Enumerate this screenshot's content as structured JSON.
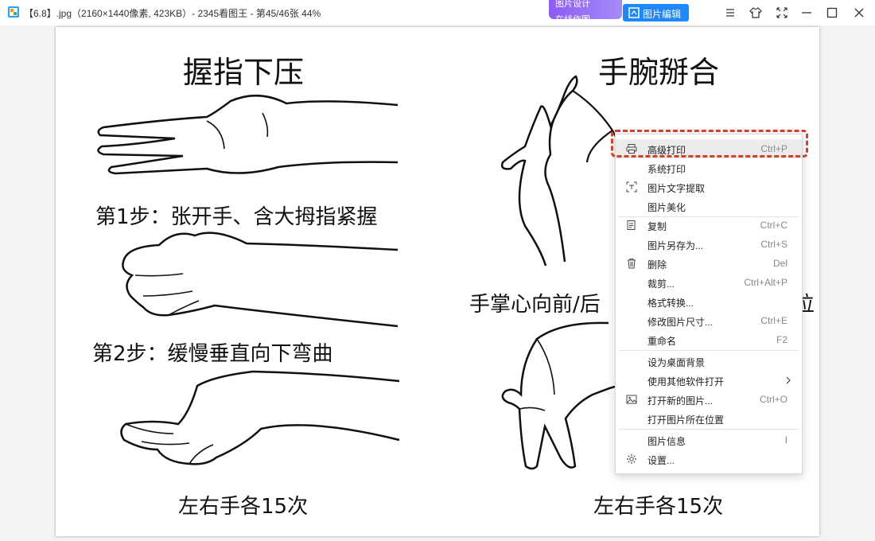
{
  "window": {
    "title": "【6.8】.jpg（2160×1440像素, 423KB）- 2345看图王 - 第45/46张 44%",
    "promo_top": "图片设计",
    "promo_bottom": "在线作图",
    "edit_button": "图片编辑",
    "icons": [
      "menu-icon",
      "skin-icon",
      "fullscreen-icon",
      "minimize-icon",
      "maximize-icon",
      "close-icon"
    ]
  },
  "image": {
    "left_title": "握指下压",
    "step1": "第1步：张开手、含大拇指紧握",
    "step2": "第2步：缓慢垂直向下弯曲",
    "left_bottom": "左右手各15次",
    "right_title": "手腕掰合",
    "right_caption_start": "手掌心向前/后",
    "right_caption_end": "位",
    "right_bottom": "左右手各15次"
  },
  "context_menu": {
    "items": [
      {
        "label": "高级打印",
        "shortcut": "Ctrl+P",
        "icon": "printer-icon",
        "highlighted": true
      },
      {
        "label": "系统打印",
        "shortcut": "",
        "icon": ""
      },
      {
        "label": "图片文字提取",
        "shortcut": "",
        "icon": "ocr-icon"
      },
      {
        "label": "图片美化",
        "shortcut": "",
        "icon": ""
      },
      {
        "label": "复制",
        "shortcut": "Ctrl+C",
        "icon": "copy-icon"
      },
      {
        "label": "图片另存为...",
        "shortcut": "Ctrl+S",
        "icon": ""
      },
      {
        "label": "删除",
        "shortcut": "Del",
        "icon": "trash-icon"
      },
      {
        "label": "裁剪...",
        "shortcut": "Ctrl+Alt+P",
        "icon": ""
      },
      {
        "label": "格式转换...",
        "shortcut": "",
        "icon": ""
      },
      {
        "label": "修改图片尺寸...",
        "shortcut": "Ctrl+E",
        "icon": ""
      },
      {
        "label": "重命名",
        "shortcut": "F2",
        "icon": ""
      },
      {
        "label": "设为桌面背景",
        "shortcut": "",
        "icon": ""
      },
      {
        "label": "使用其他软件打开",
        "shortcut": "",
        "icon": "",
        "submenu": true
      },
      {
        "label": "打开新的图片...",
        "shortcut": "Ctrl+O",
        "icon": "image-icon"
      },
      {
        "label": "打开图片所在位置",
        "shortcut": "",
        "icon": ""
      },
      {
        "label": "图片信息",
        "shortcut": "I",
        "icon": ""
      },
      {
        "label": "设置...",
        "shortcut": "",
        "icon": "gear-icon"
      }
    ]
  },
  "colors": {
    "accent": "#1e88ff",
    "highlight_ring": "#d0402a",
    "menu_hover": "#ececec"
  }
}
